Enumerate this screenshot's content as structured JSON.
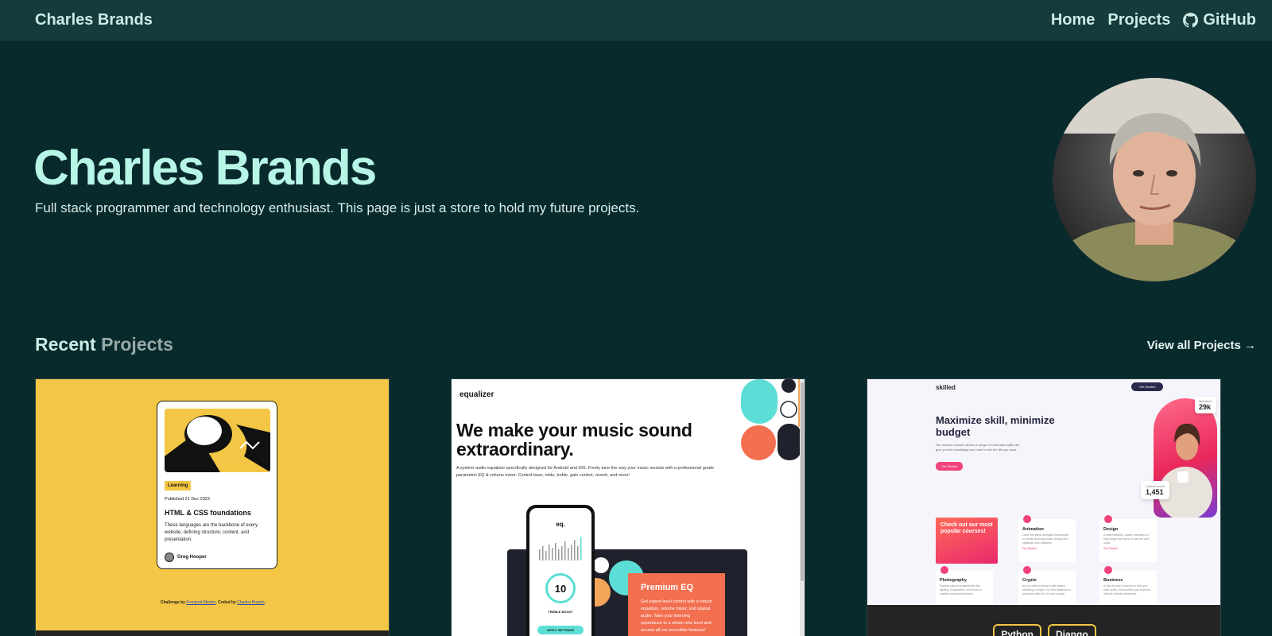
{
  "nav": {
    "brand": "Charles Brands",
    "links": [
      {
        "label": "Home"
      },
      {
        "label": "Projects"
      },
      {
        "label": "GitHub",
        "icon": "github-icon"
      }
    ]
  },
  "hero": {
    "title": "Charles Brands",
    "subtitle": "Full stack programmer and technology enthusiast. This page is just a store to hold my future projects.",
    "avatar_alt": "Profile photo"
  },
  "recent": {
    "title_a": "Recent",
    "title_b": "Projects",
    "view_all": "View all Projects →"
  },
  "cards": [
    {
      "tag": "Learning",
      "date": "Published 21 Dec 2023",
      "title": "HTML & CSS foundations",
      "desc": "These languages are the backbone of every website, defining structure, content, and presentation.",
      "author": "Greg Hooper",
      "footer_prefix": "Challenge by",
      "footer_link1": "Frontend Mentor",
      "footer_mid": ". Coded by",
      "footer_link2": "Charles Brands",
      "footer_suffix": "."
    },
    {
      "logo": "equalizer",
      "headline": "We make your music sound extraordinary.",
      "body": "A system audio equalizer specifically designed for Android and iOS. Freely tune the way your music sounds with a professional grade parametric EQ & volume mixer. Control bass, mids, treble, gain control, reverb, and more!",
      "phone_title": "eq.",
      "phone_value": "10",
      "phone_label": "TREBLE BOOST",
      "phone_button": "APPLY SETTINGS",
      "premium_title": "Premium EQ",
      "premium_desc": "Get expert-level control with a robust equalizer, volume mixer, and spatial audio. Take your listening experience to a whole new level and access all our incredible features!"
    },
    {
      "logo": "skilled",
      "get_started": "Get Started",
      "headline": "Maximize skill, minimize budget",
      "sub": "Our modern courses across a range of in-demand skills will give you the knowledge you need to live the life you want.",
      "button": "Get Started",
      "members_label": "Members",
      "members_value": "29k",
      "hours_label": "Course hours",
      "hours_value": "1,451",
      "promo": "Check out our most popular courses!",
      "items": [
        {
          "title": "Animation",
          "desc": "Learn the latest animation techniques to create stunning motion design and captivate your audience.",
          "cta": "Get Started"
        },
        {
          "title": "Design",
          "desc": "Create beautiful, usable interfaces to help shape the future of how the web looks.",
          "cta": "Get Started"
        },
        {
          "title": "Photography",
          "desc": "Explore critical fundamentals like lighting, composition, and focus to capture exceptional photos.",
          "cta": ""
        },
        {
          "title": "Crypto",
          "desc": "All you need to know to get started investing in crypto. Go from beginner to advanced with this 54 hour course.",
          "cta": ""
        },
        {
          "title": "Business",
          "desc": "A step-by-step playbook to help you start, scale, and sustain your business without outside investment.",
          "cta": ""
        }
      ],
      "tags": [
        "Python",
        "Django"
      ]
    }
  ]
}
